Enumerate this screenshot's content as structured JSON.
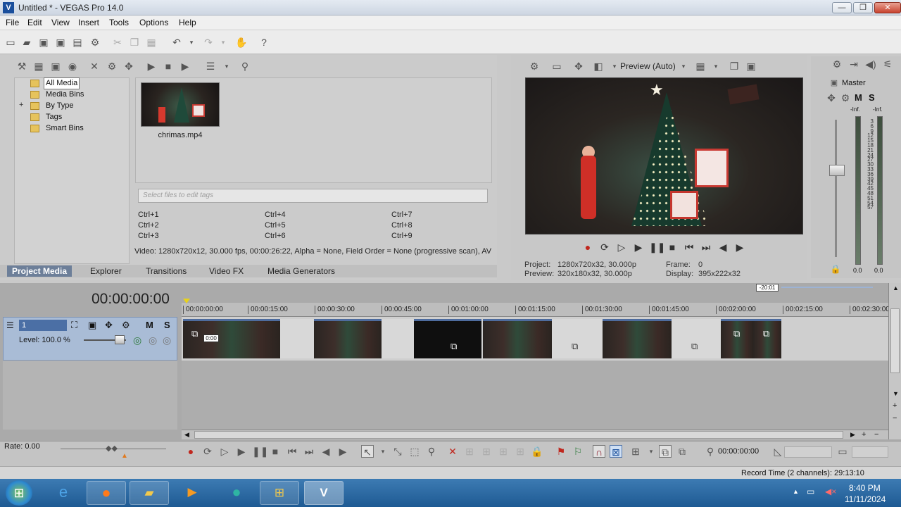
{
  "window": {
    "title": "Untitled * - VEGAS Pro 14.0",
    "app_icon": "vegas-icon",
    "minimize": "—",
    "maximize": "❐",
    "close": "✕"
  },
  "menu": [
    "File",
    "Edit",
    "View",
    "Insert",
    "Tools",
    "Options",
    "Help"
  ],
  "media_tree": {
    "items": [
      "All Media",
      "Media Bins",
      "By Type",
      "Tags",
      "Smart Bins"
    ],
    "selected": "All Media",
    "expander": "+"
  },
  "media": {
    "clip_name": "chrimas.mp4",
    "tag_placeholder": "Select files to edit tags",
    "shortcuts": [
      "Ctrl+1",
      "Ctrl+2",
      "Ctrl+3",
      "Ctrl+4",
      "Ctrl+5",
      "Ctrl+6",
      "Ctrl+7",
      "Ctrl+8",
      "Ctrl+9"
    ],
    "info": "Video: 1280x720x12, 30.000 fps, 00:00:26:22, Alpha = None, Field Order = None (progressive scan), AV"
  },
  "tabs": {
    "items": [
      "Project Media",
      "Explorer",
      "Transitions",
      "Video FX",
      "Media Generators"
    ],
    "active": "Project Media"
  },
  "preview": {
    "mode": "Preview (Auto)",
    "project_label": "Project:",
    "project_value": "1280x720x32, 30.000p",
    "preview_label": "Preview:",
    "preview_value": "320x180x32, 30.000p",
    "frame_label": "Frame:",
    "frame_value": "0",
    "display_label": "Display:",
    "display_value": "395x222x32"
  },
  "mixer": {
    "title": "Master",
    "m": "M",
    "s": "S",
    "inf_left": "-Inf.",
    "inf_right": "-Inf.",
    "scale": [
      "3",
      "6",
      "9",
      "12",
      "15",
      "18",
      "21",
      "24",
      "27",
      "30",
      "33",
      "36",
      "39",
      "42",
      "45",
      "48",
      "51",
      "54",
      "57"
    ],
    "value_left": "0.0",
    "value_right": "0.0"
  },
  "timeline": {
    "timecode": "00:00:00:00",
    "marker": "-20:01",
    "ruler": [
      "00:00:00:00",
      "00:00:15:00",
      "00:00:30:00",
      "00:00:45:00",
      "00:01:00:00",
      "00:01:15:00",
      "00:01:30:00",
      "00:01:45:00",
      "00:02:00:00",
      "00:02:15:00",
      "00:02:30:00"
    ],
    "track_number": "1",
    "track_m": "M",
    "track_s": "S",
    "level": "Level: 100.0 %",
    "clip_label": "0:00",
    "rate": "Rate: 0.00",
    "cursor_time": "00:00:00:00"
  },
  "status": {
    "record_time": "Record Time (2 channels): 29:13:10"
  },
  "taskbar": {
    "time": "8:40 PM",
    "date": "11/11/2024"
  }
}
